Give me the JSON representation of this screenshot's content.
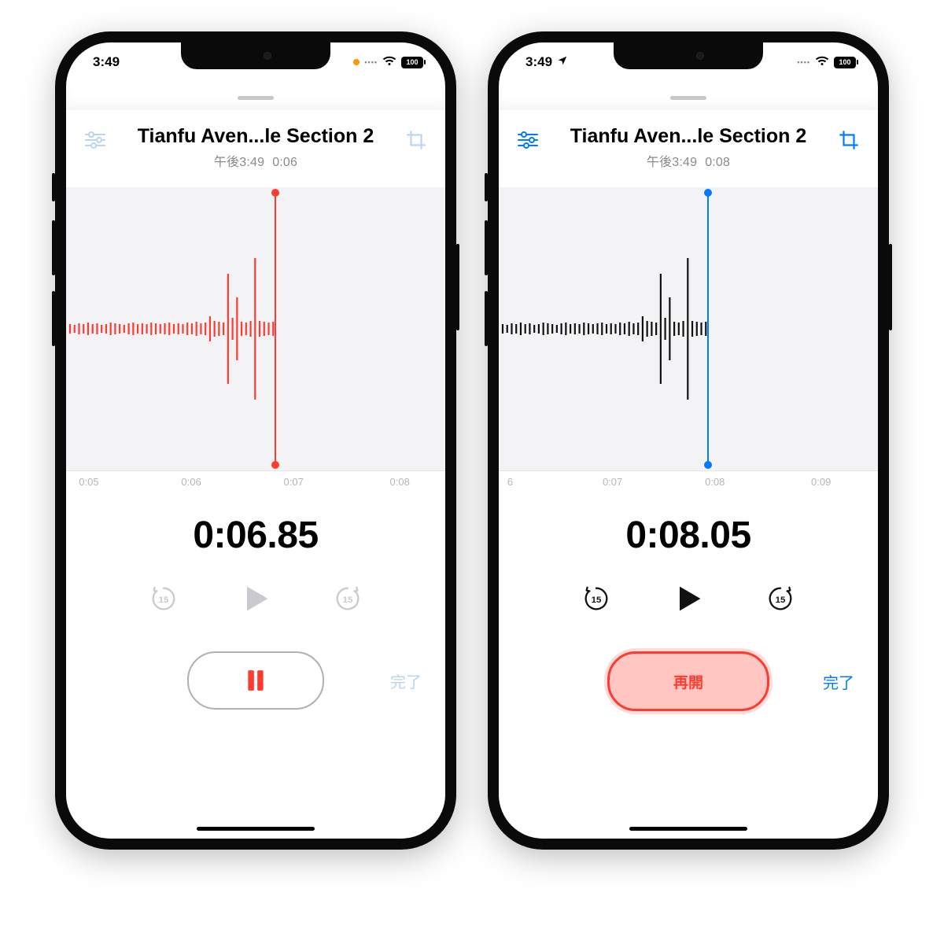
{
  "colors": {
    "accent_red": "#ff3b30",
    "accent_blue": "#007aff",
    "grey_icon_disabled": "#c9c9ce",
    "grey_icon_enabled": "#111111",
    "done_disabled": "#b8d5f5",
    "done_enabled": "#007aff",
    "waveform_red": "#ff3b30",
    "waveform_black": "#111111"
  },
  "phones": [
    {
      "status": {
        "time": "3:49",
        "show_rec_dot": true,
        "show_location": false,
        "battery": "100"
      },
      "header": {
        "title": "Tianfu Aven...le Section 2",
        "sub_time": "午後3:49",
        "sub_dur": "0:06",
        "icon_tint": "disabled"
      },
      "waveform": {
        "color": "waveform_red",
        "playhead_x_pct": 55,
        "playhead_color": "#ff3b30",
        "ticks": [
          "0:05",
          "0:06",
          "0:07",
          "0:08"
        ],
        "tick_positions_pct": [
          6,
          33,
          60,
          88
        ]
      },
      "big_time": "0:06.85",
      "transport": {
        "skip_back_label": "15",
        "skip_forward_label": "15",
        "skip_tint": "#c9c9ce",
        "play_tint": "#c9c9ce"
      },
      "main_action": {
        "kind": "pause",
        "label": ""
      },
      "done": {
        "label": "完了",
        "enabled": false
      }
    },
    {
      "status": {
        "time": "3:49",
        "show_rec_dot": false,
        "show_location": true,
        "battery": "100"
      },
      "header": {
        "title": "Tianfu Aven...le Section 2",
        "sub_time": "午後3:49",
        "sub_dur": "0:08",
        "icon_tint": "enabled"
      },
      "waveform": {
        "color": "waveform_black",
        "playhead_x_pct": 55,
        "playhead_color": "#007aff",
        "ticks": [
          "6",
          "0:07",
          "0:08",
          "0:09"
        ],
        "tick_positions_pct": [
          3,
          30,
          57,
          85
        ]
      },
      "big_time": "0:08.05",
      "transport": {
        "skip_back_label": "15",
        "skip_forward_label": "15",
        "skip_tint": "#111111",
        "play_tint": "#111111"
      },
      "main_action": {
        "kind": "resume",
        "label": "再開"
      },
      "done": {
        "label": "完了",
        "enabled": true
      }
    }
  ],
  "wave_heights": [
    6,
    5,
    7,
    6,
    8,
    6,
    7,
    5,
    6,
    8,
    7,
    6,
    5,
    7,
    8,
    6,
    7,
    6,
    8,
    7,
    6,
    7,
    8,
    6,
    7,
    6,
    8,
    7,
    9,
    7,
    8,
    16,
    10,
    9,
    8,
    70,
    14,
    40,
    9,
    8,
    10,
    90,
    10,
    9,
    8,
    9
  ]
}
